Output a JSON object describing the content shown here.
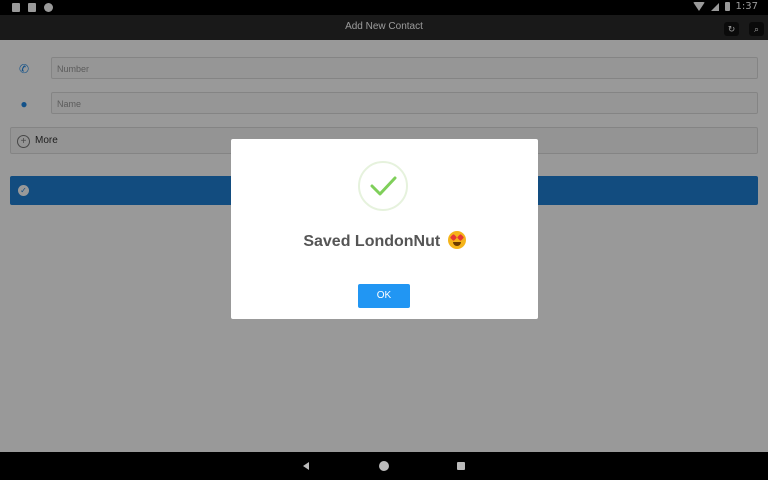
{
  "status_bar": {
    "time": "1:37"
  },
  "appbar": {
    "title": "Add New Contact"
  },
  "form": {
    "number_placeholder": "Number",
    "name_placeholder": "Name",
    "more_label": "More"
  },
  "dialog": {
    "message": "Saved LondonNut",
    "ok_label": "OK"
  },
  "icons": {
    "phone": "phone-icon",
    "person": "person-icon",
    "plus": "plus-circle-icon",
    "check": "check-circle-icon",
    "refresh": "refresh-icon",
    "search": "search-icon",
    "success": "success-check-icon",
    "emoji": "star-struck-emoji-icon"
  },
  "colors": {
    "accent": "#1f7fd4",
    "ok_button": "#2196f3",
    "success_check": "#7fcf5a",
    "appbar": "#2b2b2b"
  }
}
